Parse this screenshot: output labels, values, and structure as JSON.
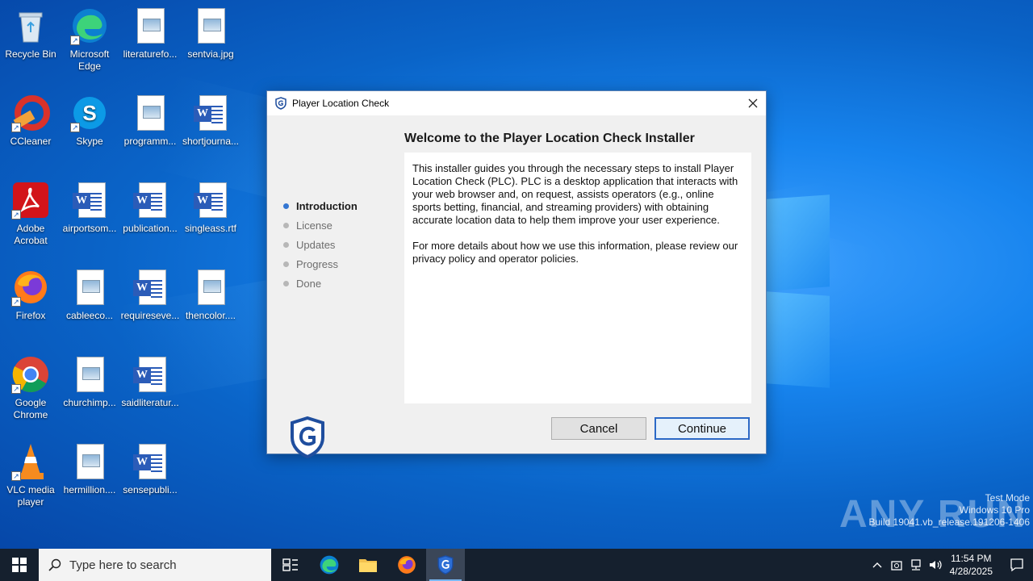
{
  "desktop": {
    "icons": [
      {
        "label": "Recycle Bin"
      },
      {
        "label": "Microsoft Edge"
      },
      {
        "label": "literaturefo..."
      },
      {
        "label": "sentvia.jpg"
      },
      {
        "label": "CCleaner"
      },
      {
        "label": "Skype"
      },
      {
        "label": "programm..."
      },
      {
        "label": "shortjourna..."
      },
      {
        "label": "Adobe Acrobat"
      },
      {
        "label": "airportsom..."
      },
      {
        "label": "publication..."
      },
      {
        "label": "singleass.rtf"
      },
      {
        "label": "Firefox"
      },
      {
        "label": "cableeco..."
      },
      {
        "label": "requireseve..."
      },
      {
        "label": "thencolor...."
      },
      {
        "label": "Google Chrome"
      },
      {
        "label": "churchimp..."
      },
      {
        "label": "saidliteratur..."
      },
      {
        "label": "VLC media player"
      },
      {
        "label": "hermillion...."
      },
      {
        "label": "sensepubli..."
      }
    ]
  },
  "dialog": {
    "title": "Player Location Check",
    "heading": "Welcome to the Player Location Check Installer",
    "paragraph1": "This installer guides you through the necessary steps to install Player Location Check (PLC). PLC is a desktop application that interacts with your web browser and, on request, assists operators (e.g., online sports betting, financial, and streaming providers) with obtaining accurate location data to help them improve your user experience.",
    "paragraph2": "For more details about how we use this information, please review our privacy policy and operator policies.",
    "steps": [
      "Introduction",
      "License",
      "Updates",
      "Progress",
      "Done"
    ],
    "active_step": "Introduction",
    "cancel_label": "Cancel",
    "continue_label": "Continue",
    "accent_color": "#2c69c6"
  },
  "watermark": {
    "brand": "ANY RUN",
    "line1": "Test Mode",
    "line2": "Windows 10 Pro",
    "line3": "Build 19041.vb_release.191206-1406"
  },
  "taskbar": {
    "search_placeholder": "Type here to search",
    "time": "11:54 PM",
    "date": "4/28/2025"
  }
}
